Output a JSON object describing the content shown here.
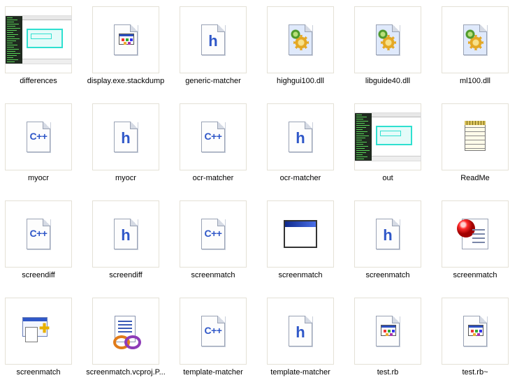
{
  "view": "thumbnails",
  "files": [
    {
      "name": "differences",
      "icon": "screenshot-thumbnail-icon"
    },
    {
      "name": "display.exe.stackdump",
      "icon": "generic-app-file-icon"
    },
    {
      "name": "generic-matcher",
      "icon": "c-header-file-icon"
    },
    {
      "name": "highgui100.dll",
      "icon": "dll-file-icon"
    },
    {
      "name": "libguide40.dll",
      "icon": "dll-file-icon"
    },
    {
      "name": "ml100.dll",
      "icon": "dll-file-icon"
    },
    {
      "name": "myocr",
      "icon": "cpp-source-file-icon"
    },
    {
      "name": "myocr",
      "icon": "c-header-file-icon"
    },
    {
      "name": "ocr-matcher",
      "icon": "cpp-source-file-icon"
    },
    {
      "name": "ocr-matcher",
      "icon": "c-header-file-icon"
    },
    {
      "name": "out",
      "icon": "screenshot-thumbnail-icon"
    },
    {
      "name": "ReadMe",
      "icon": "notepad-text-file-icon"
    },
    {
      "name": "screendiff",
      "icon": "cpp-source-file-icon"
    },
    {
      "name": "screendiff",
      "icon": "c-header-file-icon"
    },
    {
      "name": "screenmatch",
      "icon": "cpp-source-file-icon"
    },
    {
      "name": "screenmatch",
      "icon": "executable-window-icon"
    },
    {
      "name": "screenmatch",
      "icon": "c-header-file-icon"
    },
    {
      "name": "screenmatch",
      "icon": "ruby-file-icon"
    },
    {
      "name": "screenmatch",
      "icon": "application-windows-icon"
    },
    {
      "name": "screenmatch.vcproj.P...",
      "icon": "vcproj-file-icon"
    },
    {
      "name": "template-matcher",
      "icon": "cpp-source-file-icon"
    },
    {
      "name": "template-matcher",
      "icon": "c-header-file-icon"
    },
    {
      "name": "test.rb",
      "icon": "generic-app-file-icon"
    },
    {
      "name": "test.rb~",
      "icon": "generic-app-file-icon"
    }
  ],
  "glyphs": {
    "h": "h",
    "cpp": "C++"
  }
}
